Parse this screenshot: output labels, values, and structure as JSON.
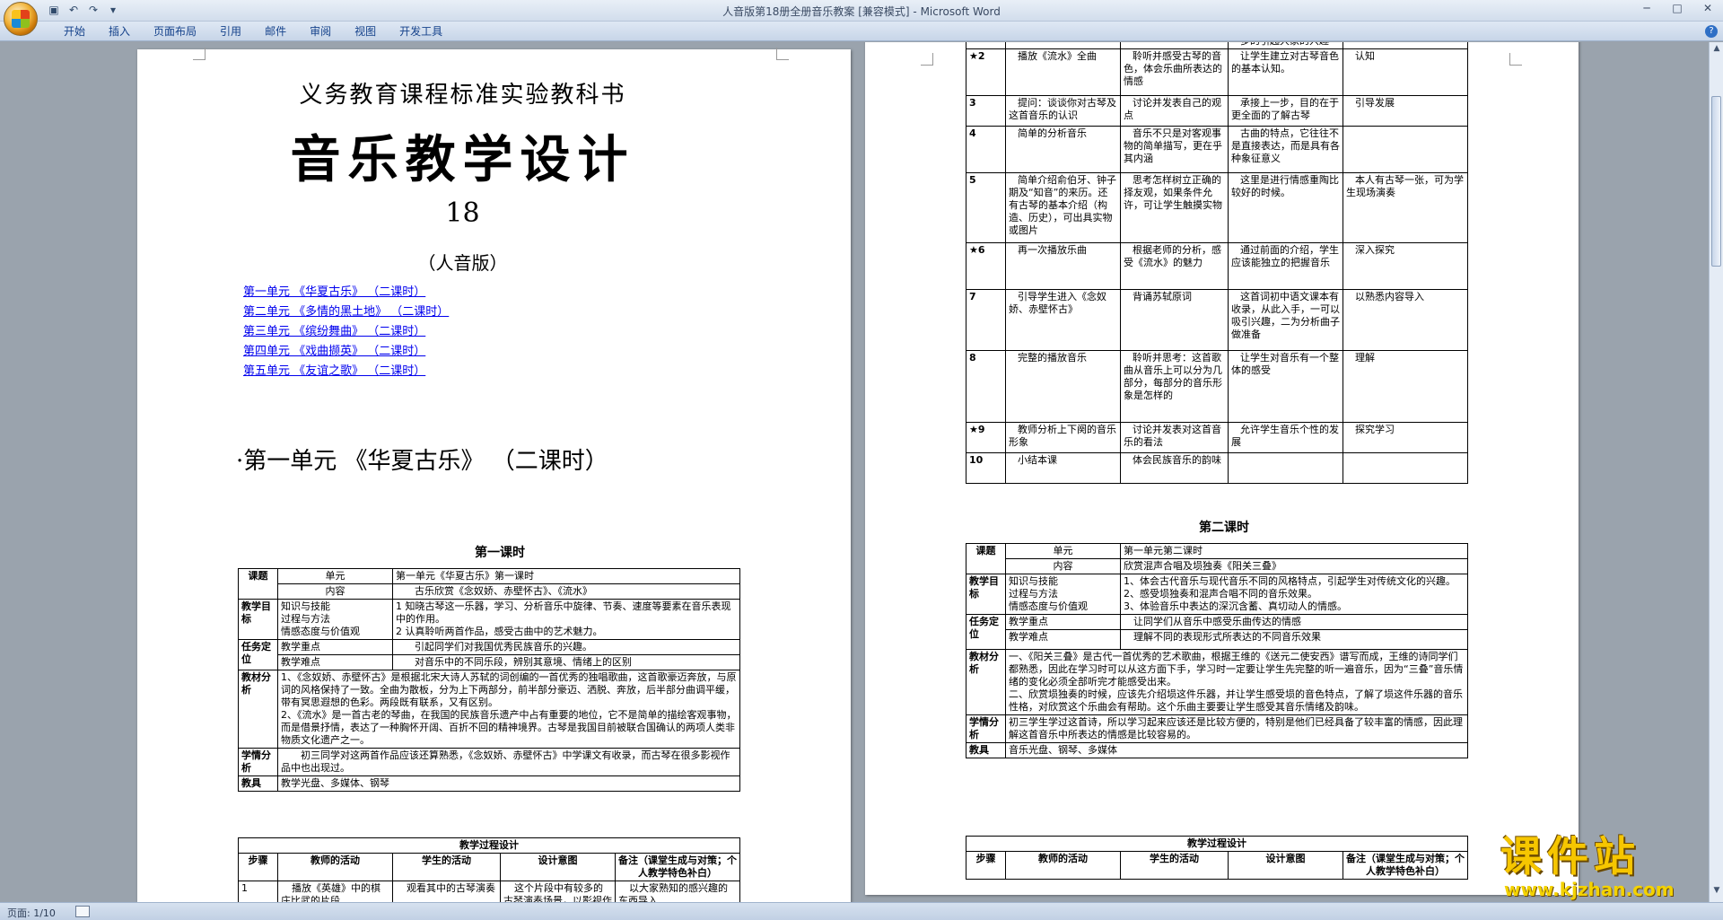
{
  "window": {
    "title": "人音版第18册全册音乐教案 [兼容模式] - Microsoft Word",
    "qat_icons": [
      "save-icon",
      "undo-icon",
      "redo-icon",
      "customize-icon"
    ]
  },
  "ribbon": {
    "tabs": [
      "开始",
      "插入",
      "页面布局",
      "引用",
      "邮件",
      "审阅",
      "视图",
      "开发工具"
    ]
  },
  "page1": {
    "title1": "义务教育课程标准实验教科书",
    "title2": "音乐教学设计",
    "title3": "18",
    "title4": "（人音版）",
    "toc": [
      "第一单元 《华夏古乐》 （二课时）",
      "第二单元 《多情的黑土地》 （二课时）",
      "第三单元 《缤纷舞曲》 （二课时）",
      "第四单元 《戏曲撷英》 （二课时）",
      "第五单元 《友谊之歌》 （二课时）"
    ],
    "unit_heading": "·第一单元 《华夏古乐》 （二课时）",
    "lesson_heading": "第一课时",
    "table": {
      "r1": {
        "label": "课题",
        "a1": "单元",
        "a1v": "第一单元《华夏古乐》第一课时",
        "a2": "内容",
        "a2v": "古乐欣赏《念奴娇、赤壁怀古》、《流水》"
      },
      "r2": {
        "label": "教学目标",
        "k": "知识与技能\n过程与方法\n情感态度与价值观",
        "v": "1 知晓古琴这一乐器，学习、分析音乐中旋律、节奏、速度等要素在音乐表现中的作用。\n2 认真聆听两首作品，感受古曲中的艺术魅力。"
      },
      "r3": {
        "label": "任务定位",
        "a1": "教学重点",
        "a1v": "引起同学们对我国优秀民族音乐的兴趣。",
        "a2": "教学难点",
        "a2v": "对音乐中的不同乐段，辨别其意境、情绪上的区别"
      },
      "r4": {
        "label": "教材分析",
        "v": "1、《念奴娇、赤壁怀古》是根据北宋大诗人苏轼的词创编的一首优秀的独唱歌曲，这首歌豪迈奔放，与原词的风格保持了一致。全曲为散板，分为上下两部分，前半部分豪迈、洒脱、奔放，后半部分曲调平缓，带有冥思遐想的色彩。两段既有联系，又有区别。\n2、《流水》是一首古老的琴曲，在我国的民族音乐遗产中占有重要的地位，它不是简单的描绘客观事物，而是借景抒情，表达了一种胸怀开阔、百折不回的精神境界。古琴是我国目前被联合国确认的两项人类非物质文化遗产之一。"
      },
      "r5": {
        "label": "学情分析",
        "v": "初三同学对这两首作品应该还算熟悉，《念奴娇、赤壁怀古》中学课文有收录，而古琴在很多影视作品中也出现过。"
      },
      "r6": {
        "label": "教具",
        "v": "教学光盘、多媒体、钢琴"
      },
      "process_title": "教学过程设计",
      "headers": [
        "步骤",
        "教师的活动",
        "学生的活动",
        "设计意图",
        "备注（课堂生成与对策；个人教学特色补白）"
      ],
      "row1": [
        "1",
        "播放《英雄》中的棋庄比武的片段",
        "观看其中的古琴演奏",
        "这个片段中有较多的古琴演奏场景，以影视作品引入古琴，会更",
        "以大家熟知的感兴趣的东西导入"
      ]
    }
  },
  "page2": {
    "rows": [
      [
        "",
        "",
        "",
        "多的引起大家的兴趣",
        ""
      ],
      [
        "★2",
        "播放《流水》全曲",
        "聆听并感受古琴的音色，体会乐曲所表达的情感",
        "让学生建立对古琴音色的基本认知。",
        "认知"
      ],
      [
        "3",
        "提问：谈谈你对古琴及这首音乐的认识",
        "讨论并发表自己的观点",
        "承接上一步，目的在于更全面的了解古琴",
        "引导发展"
      ],
      [
        "4",
        "简单的分析音乐",
        "音乐不只是对客观事物的简单描写，更在乎其内涵",
        "古曲的特点，它往往不是直接表达，而是具有各种象征意义",
        ""
      ],
      [
        "5",
        "简单介绍俞伯牙、钟子期及“知音”的来历。还有古琴的基本介绍（构造、历史），可出具实物或图片",
        "思考怎样树立正确的择友观，如果条件允许，可让学生触摸实物",
        "这里是进行情感重陶比较好的时候。",
        "本人有古琴一张，可为学生现场演奏"
      ],
      [
        "★6",
        "再一次播放乐曲",
        "根据老师的分析，感受《流水》的魅力",
        "通过前面的介绍，学生应该能独立的把握音乐",
        "深入探究"
      ],
      [
        "7",
        "引导学生进入《念奴娇、赤壁怀古》",
        "背诵苏轼原词",
        "这首词初中语文课本有收录，从此入手，一可以吸引兴趣，二为分析曲子做准备",
        "以熟悉内容导入"
      ],
      [
        "8",
        "完整的播放音乐",
        "聆听并思考：这首歌曲从音乐上可以分为几部分，每部分的音乐形象是怎样的",
        "让学生对音乐有一个整体的感受",
        "理解"
      ],
      [
        "★9",
        "教师分析上下阕的音乐形象",
        "讨论并发表对这首音乐的看法",
        "允许学生音乐个性的发展",
        "探究学习"
      ],
      [
        "10",
        "小结本课",
        "体会民族音乐的韵味",
        "",
        ""
      ]
    ],
    "lesson_heading": "第二课时",
    "table": {
      "r1": {
        "label": "课题",
        "a1": "单元",
        "a1v": "第一单元第二课时",
        "a2": "内容",
        "a2v": "欣赏混声合唱及埙独奏《阳关三叠》"
      },
      "r2": {
        "label": "教学目标",
        "k": "知识与技能\n过程与方法\n情感态度与价值观",
        "v": "1、体会古代音乐与现代音乐不同的风格特点，引起学生对传统文化的兴趣。\n2、感受埙独奏和混声合唱不同的音乐效果。\n3、体验音乐中表达的深沉含蓄、真切动人的情感。"
      },
      "r3": {
        "label": "任务定位",
        "a1": "教学重点",
        "a1v": "让同学们从音乐中感受乐曲传达的情感",
        "a2": "教学难点",
        "a2v": "理解不同的表现形式所表达的不同音乐效果"
      },
      "r4": {
        "label": "教材分析",
        "v": "一、《阳关三叠》是古代一首优秀的艺术歌曲，根据王维的《送元二使安西》谱写而成，王维的诗同学们都熟悉，因此在学习时可以从这方面下手，学习时一定要让学生先完整的听一遍音乐，因为“三叠”音乐情绪的变化必须全部听完才能感受出来。\n二、欣赏埙独奏的时候，应该先介绍埙这件乐器，并让学生感受埙的音色特点，了解了埙这件乐器的音乐性格，对欣赏这个乐曲会有帮助。这个乐曲主要要让学生感受其音乐情绪及韵味。"
      },
      "r5": {
        "label": "学情分析",
        "v": "初三学生学过这首诗，所以学习起来应该还是比较方便的，特别是他们已经具备了较丰富的情感，因此理解这首音乐中所表达的情感是比较容易的。"
      },
      "r6": {
        "label": "教具",
        "v": "音乐光盘、钢琴、多媒体"
      },
      "process_title": "教学过程设计",
      "headers": [
        "步骤",
        "教师的活动",
        "学生的活动",
        "设计意图",
        "备注（课堂生成与对策；个人教学特色补白）"
      ]
    }
  },
  "statusbar": {
    "page": "页面: 1/10"
  },
  "watermark": {
    "text": "课件站",
    "url": "www.kjzhan.com"
  }
}
